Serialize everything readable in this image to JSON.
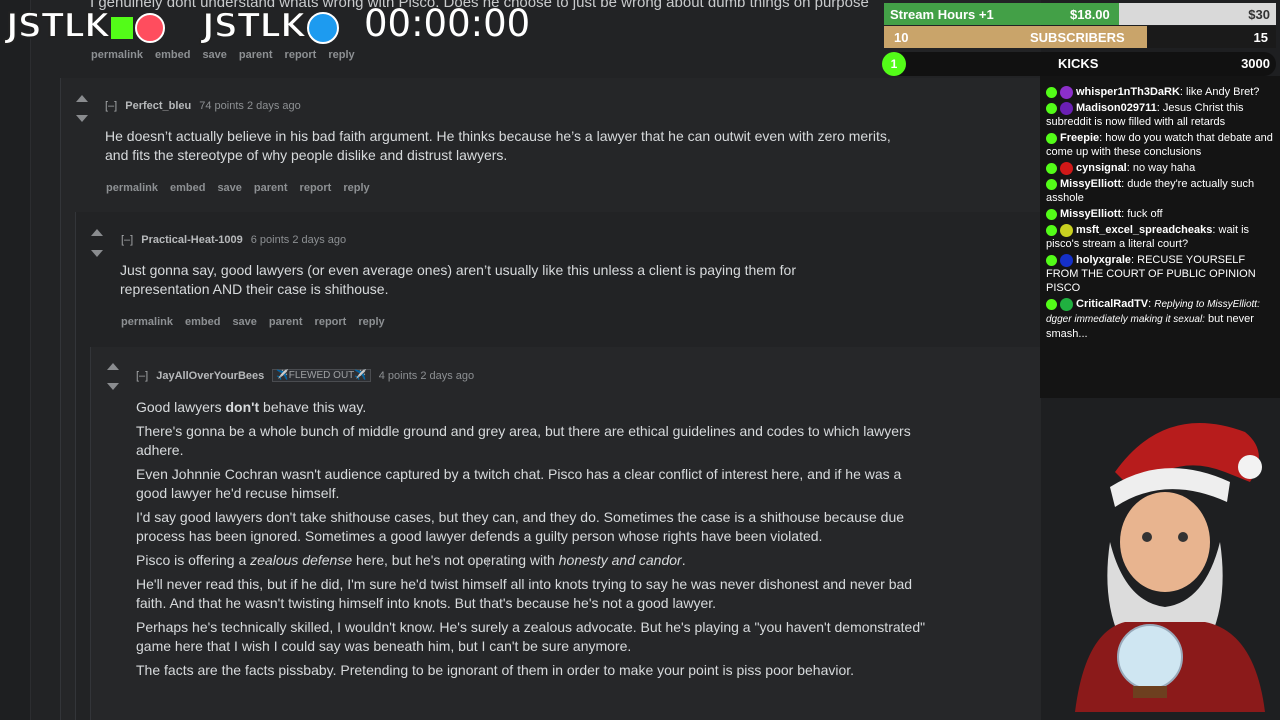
{
  "overlay": {
    "logo_kick": "JSTLK",
    "logo_twitter": "JSTLK",
    "timer": "00:00:00",
    "stream_hours_label": "Stream Hours +1",
    "stream_hours_value": "$18.00",
    "stream_hours_target": "$30",
    "stream_hours_fraction": 0.6,
    "subs_left": "10",
    "subs_label": "SUBSCRIBERS",
    "subs_right": "15",
    "subs_fraction": 0.67,
    "kicks_left": "1",
    "kicks_label": "KICKS",
    "kicks_right": "3000"
  },
  "thread": {
    "cut_top_text": "I genuinely dont understand whats wrong with Pisco. Does he choose to just be wrong about dumb things on purpose",
    "top_links": [
      "permalink",
      "embed",
      "save",
      "parent",
      "report",
      "reply"
    ],
    "comments": [
      {
        "toggle": "[–]",
        "author": "Perfect_bleu",
        "meta": "74 points 2 days ago",
        "paragraphs": [
          "He doesn’t actually believe in his bad faith argument. He thinks because he’s a lawyer that he can outwit even with zero merits, and fits the stereotype of why people dislike and distrust lawyers."
        ],
        "links": [
          "permalink",
          "embed",
          "save",
          "parent",
          "report",
          "reply"
        ]
      },
      {
        "toggle": "[–]",
        "author": "Practical-Heat-1009",
        "meta": "6 points 2 days ago",
        "paragraphs": [
          "Just gonna say, good lawyers (or even average ones) aren’t usually like this unless a client is paying them for representation AND their case is shithouse."
        ],
        "links": [
          "permalink",
          "embed",
          "save",
          "parent",
          "report",
          "reply"
        ]
      },
      {
        "toggle": "[–]",
        "author": "JayAllOverYourBees",
        "flair": "✈️FLEWED OUT✈️",
        "meta": "4 points 2 days ago",
        "p1_pre": "Good lawyers ",
        "p1_bold": "don't",
        "p1_post": " behave this way.",
        "p2": "There's gonna be a whole bunch of middle ground and grey area, but there are ethical guidelines and codes to which lawyers adhere.",
        "p3": "Even Johnnie Cochran wasn't audience captured by a twitch chat. Pisco has a clear conflict of interest here, and if he was a good lawyer he'd recuse himself.",
        "p4": "I'd say good lawyers don't take shithouse cases, but they can, and they do. Sometimes the case is a shithouse because due process has been ignored. Sometimes a good lawyer defends a guilty person whose rights have been violated.",
        "p5_pre": "Pisco is offering a ",
        "p5_em1": "zealous defense",
        "p5_mid": " here, but he's not operating with ",
        "p5_em2": "honesty and candor",
        "p5_post": ".",
        "p6": "He'll never read this, but if he did, I'm sure he'd twist himself all into knots trying to say he was never dishonest and never bad faith. And that he wasn't twisting himself into knots. But that's because he's not a good lawyer.",
        "p7": "Perhaps he's technically skilled, I wouldn't know. He's surely a zealous advocate. But he's playing a \"you haven't demonstrated\" game here that I wish I could say was beneath him, but I can't be sure anymore.",
        "p8": "The facts are the facts pissbaby. Pretending to be ignorant of them in order to make your point is piss poor behavior."
      }
    ]
  },
  "chat": [
    {
      "name": "whisper1nTh3DaRK",
      "dot": "#8b2fc9",
      "text": "like Andy Bret?"
    },
    {
      "name": "Madison029711",
      "dot": "#6a1fb3",
      "text": "Jesus Christ this subreddit is now filled with all retards"
    },
    {
      "name": "Freepie",
      "dot": "",
      "text": "how do you watch that debate and come up with these conclusions"
    },
    {
      "name": "cynsignal",
      "dot": "#d01818",
      "text": "no way haha"
    },
    {
      "name": "MissyElliott",
      "dot": "",
      "text": "dude they're actually such asshole"
    },
    {
      "name": "MissyElliott",
      "dot": "",
      "text": "fuck off"
    },
    {
      "name": "msft_excel_spreadcheaks",
      "dot": "#c8d020",
      "text": "wait is pisco's stream a literal court?"
    },
    {
      "name": "holyxgrale",
      "dot": "#1530c8",
      "text": "RECUSE YOURSELF FROM THE COURT OF PUBLIC OPINION PISCO"
    },
    {
      "name": "CriticalRadTV",
      "dot": "#20b040",
      "reply": "Replying to MissyElliott: dgger immediately making it sexual:",
      "text": "but never smash..."
    }
  ],
  "colors": {
    "kick_green": "#53fc18",
    "subs_gold": "#c9a46a",
    "money_green": "#4caf50"
  }
}
